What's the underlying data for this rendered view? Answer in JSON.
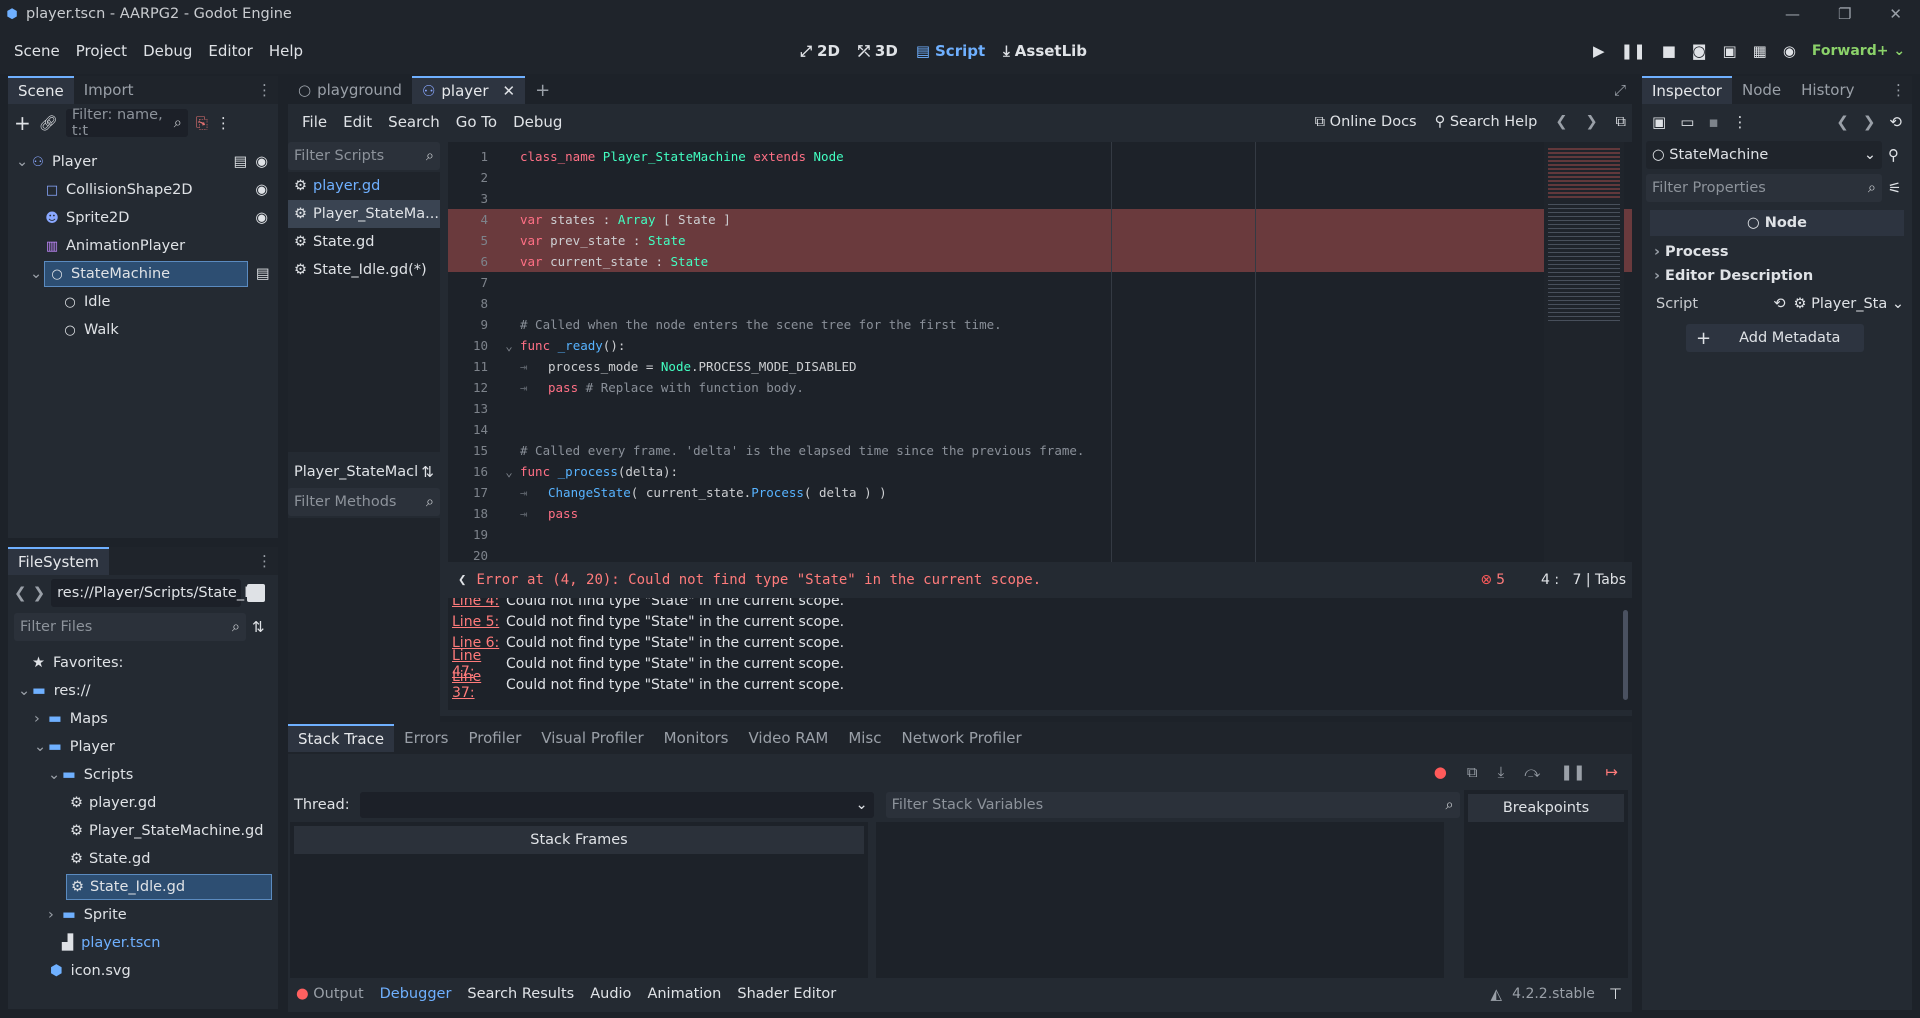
{
  "window": {
    "title": "player.tscn - AARPG2 - Godot Engine"
  },
  "menu": {
    "items": [
      "Scene",
      "Project",
      "Debug",
      "Editor",
      "Help"
    ]
  },
  "workspaces": {
    "items": [
      "2D",
      "3D",
      "Script",
      "AssetLib"
    ],
    "active": "Script"
  },
  "renderer": "Forward+",
  "scene_dock": {
    "tabs": [
      "Scene",
      "Import"
    ],
    "filter_placeholder": "Filter: name, t:t",
    "tree": [
      {
        "label": "Player",
        "indent": 0
      },
      {
        "label": "CollisionShape2D",
        "indent": 1
      },
      {
        "label": "Sprite2D",
        "indent": 1
      },
      {
        "label": "AnimationPlayer",
        "indent": 1
      },
      {
        "label": "StateMachine",
        "indent": 1
      },
      {
        "label": "Idle",
        "indent": 2
      },
      {
        "label": "Walk",
        "indent": 2
      }
    ]
  },
  "filesystem": {
    "tab": "FileSystem",
    "path": "res://Player/Scripts/State_I",
    "filter_placeholder": "Filter Files",
    "items": [
      {
        "label": "Favorites:"
      },
      {
        "label": "res://"
      },
      {
        "label": "Maps"
      },
      {
        "label": "Player"
      },
      {
        "label": "Scripts"
      },
      {
        "label": "player.gd"
      },
      {
        "label": "Player_StateMachine.gd"
      },
      {
        "label": "State.gd"
      },
      {
        "label": "State_Idle.gd"
      },
      {
        "label": "Sprite"
      },
      {
        "label": "player.tscn"
      },
      {
        "label": "icon.svg"
      }
    ]
  },
  "scene_tabs": [
    "playground",
    "player"
  ],
  "script_menu": {
    "items": [
      "File",
      "Edit",
      "Search",
      "Go To",
      "Debug"
    ],
    "online_docs": "Online Docs",
    "search_help": "Search Help"
  },
  "script_list": {
    "filter_placeholder": "Filter Scripts",
    "items": [
      "player.gd",
      "Player_StateMa...",
      "State.gd",
      "State_Idle.gd(*)"
    ],
    "current": "Player_StateMacl",
    "methods_placeholder": "Filter Methods"
  },
  "code": {
    "lines": [
      {
        "n": "1",
        "parts": [
          {
            "c": "kw",
            "t": "class_name "
          },
          {
            "c": "ty",
            "t": "Player_StateMachine "
          },
          {
            "c": "kw",
            "t": "extends "
          },
          {
            "c": "ty",
            "t": "Node"
          }
        ]
      },
      {
        "n": "2",
        "parts": []
      },
      {
        "n": "3",
        "parts": []
      },
      {
        "n": "4",
        "err": true,
        "parts": [
          {
            "c": "kw",
            "t": "var "
          },
          {
            "c": "tx",
            "t": "states : "
          },
          {
            "c": "ty",
            "t": "Array"
          },
          {
            "c": "tx",
            "t": " [ State ]"
          }
        ]
      },
      {
        "n": "5",
        "err": true,
        "parts": [
          {
            "c": "kw",
            "t": "var "
          },
          {
            "c": "tx",
            "t": "prev_state : "
          },
          {
            "c": "ty",
            "t": "State"
          }
        ]
      },
      {
        "n": "6",
        "err": true,
        "parts": [
          {
            "c": "kw",
            "t": "var "
          },
          {
            "c": "tx",
            "t": "current_state : "
          },
          {
            "c": "ty",
            "t": "State"
          }
        ]
      },
      {
        "n": "7",
        "parts": []
      },
      {
        "n": "8",
        "parts": []
      },
      {
        "n": "9",
        "parts": [
          {
            "c": "cm",
            "t": "# Called when the node enters the scene tree for the first time."
          }
        ]
      },
      {
        "n": "10",
        "fold": true,
        "parts": [
          {
            "c": "kw",
            "t": "func "
          },
          {
            "c": "fn",
            "t": "_ready"
          },
          {
            "c": "tx",
            "t": "():"
          }
        ]
      },
      {
        "n": "11",
        "tab": true,
        "parts": [
          {
            "c": "tx",
            "t": "process_mode = "
          },
          {
            "c": "ty",
            "t": "Node"
          },
          {
            "c": "tx",
            "t": ".PROCESS_MODE_DISABLED"
          }
        ]
      },
      {
        "n": "12",
        "tab": true,
        "parts": [
          {
            "c": "kw",
            "t": "pass "
          },
          {
            "c": "cm",
            "t": "# Replace with function body."
          }
        ]
      },
      {
        "n": "13",
        "parts": []
      },
      {
        "n": "14",
        "parts": []
      },
      {
        "n": "15",
        "parts": [
          {
            "c": "cm",
            "t": "# Called every frame. 'delta' is the elapsed time since the previous frame."
          }
        ]
      },
      {
        "n": "16",
        "fold": true,
        "parts": [
          {
            "c": "kw",
            "t": "func "
          },
          {
            "c": "fn",
            "t": "_process"
          },
          {
            "c": "tx",
            "t": "(delta):"
          }
        ]
      },
      {
        "n": "17",
        "tab": true,
        "parts": [
          {
            "c": "fn",
            "t": "ChangeState"
          },
          {
            "c": "tx",
            "t": "( current_state."
          },
          {
            "c": "fn",
            "t": "Process"
          },
          {
            "c": "tx",
            "t": "( delta ) )"
          }
        ]
      },
      {
        "n": "18",
        "tab": true,
        "parts": [
          {
            "c": "kw",
            "t": "pass"
          }
        ]
      },
      {
        "n": "19",
        "parts": []
      },
      {
        "n": "20",
        "parts": []
      }
    ]
  },
  "status": {
    "error": "Error at (4, 20): Could not find type \"State\" in the current scope.",
    "error_count": "5",
    "cursor": "4 :   7 | Tabs"
  },
  "errors": [
    {
      "line": "Line 4:",
      "msg": "Could not find type \"State\" in the current scope."
    },
    {
      "line": "Line 5:",
      "msg": "Could not find type \"State\" in the current scope."
    },
    {
      "line": "Line 6:",
      "msg": "Could not find type \"State\" in the current scope."
    },
    {
      "line": "Line 47:",
      "msg": "Could not find type \"State\" in the current scope."
    },
    {
      "line": "Line 37:",
      "msg": "Could not find type \"State\" in the current scope."
    }
  ],
  "debugger": {
    "tabs": [
      "Stack Trace",
      "Errors",
      "Profiler",
      "Visual Profiler",
      "Monitors",
      "Video RAM",
      "Misc",
      "Network Profiler"
    ],
    "thread_label": "Thread:",
    "stack_frames": "Stack Frames",
    "filter_vars": "Filter Stack Variables",
    "breakpoints": "Breakpoints"
  },
  "bottom_tabs": {
    "items": [
      "Output",
      "Debugger",
      "Search Results",
      "Audio",
      "Animation",
      "Shader Editor"
    ],
    "version": "4.2.2.stable"
  },
  "inspector": {
    "tabs": [
      "Inspector",
      "Node",
      "History"
    ],
    "object": "StateMachine",
    "filter_placeholder": "Filter Properties",
    "section": "Node",
    "groups": [
      "Process",
      "Editor Description"
    ],
    "script_label": "Script",
    "script_value": "Player_Sta",
    "add_metadata": "Add Metadata"
  },
  "colors": {
    "accent": "#6fb0ff",
    "error": "#ff6b6b",
    "error_line_bg": "#6a3a3d"
  }
}
